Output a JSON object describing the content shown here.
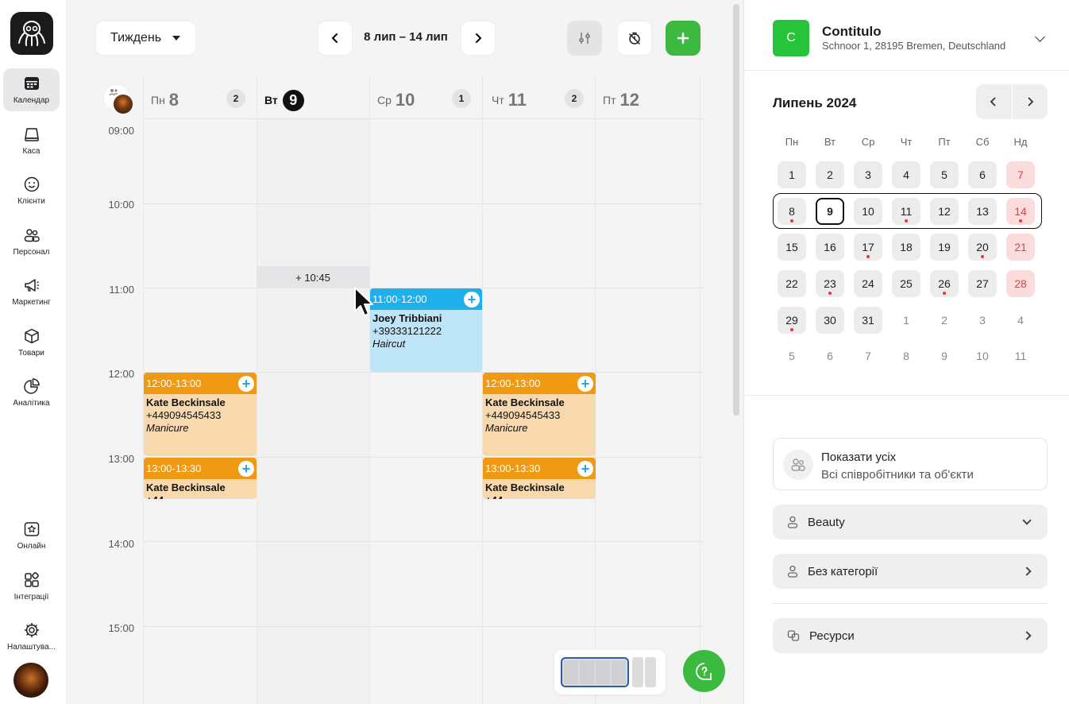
{
  "sidebar": {
    "items": [
      {
        "label": "Календар",
        "icon": "calendar-icon"
      },
      {
        "label": "Каса",
        "icon": "cash-register-icon"
      },
      {
        "label": "Клієнти",
        "icon": "smile-icon"
      },
      {
        "label": "Персонал",
        "icon": "staff-icon"
      },
      {
        "label": "Маркетинг",
        "icon": "megaphone-icon"
      },
      {
        "label": "Товари",
        "icon": "box-icon"
      },
      {
        "label": "Аналітика",
        "icon": "pie-chart-icon"
      },
      {
        "label": "Онлайн",
        "icon": "star-icon"
      },
      {
        "label": "Інтеграції",
        "icon": "integrations-icon"
      },
      {
        "label": "Налаштува...",
        "icon": "gear-icon"
      }
    ]
  },
  "toolbar": {
    "view_label": "Тиждень",
    "date_range": "8 лип – 14 лип"
  },
  "days": [
    {
      "weekday": "Пн",
      "num": "8",
      "count": "2"
    },
    {
      "weekday": "Вт",
      "num": "9",
      "count": ""
    },
    {
      "weekday": "Ср",
      "num": "10",
      "count": "1"
    },
    {
      "weekday": "Чт",
      "num": "11",
      "count": "2"
    },
    {
      "weekday": "Пт",
      "num": "12",
      "count": ""
    }
  ],
  "hours": [
    "09:00",
    "10:00",
    "11:00",
    "12:00",
    "13:00",
    "14:00",
    "15:00"
  ],
  "hover_slot": "+ 10:45",
  "events": [
    {
      "time": "11:00-12:00",
      "name": "Joey Tribbiani",
      "phone": "+39333121222",
      "service": "Haircut",
      "color": "blue"
    },
    {
      "time": "12:00-13:00",
      "name": "Kate Beckinsale",
      "phone": "+449094545433",
      "service": "Manicure",
      "color": "orange"
    },
    {
      "time": "13:00-13:30",
      "name": "Kate Beckinsale +44...",
      "phone": "",
      "service": "",
      "color": "orange"
    },
    {
      "time": "12:00-13:00",
      "name": "Kate Beckinsale",
      "phone": "+449094545433",
      "service": "Manicure",
      "color": "orange"
    },
    {
      "time": "13:00-13:30",
      "name": "Kate Beckinsale +44...",
      "phone": "",
      "service": "",
      "color": "orange"
    }
  ],
  "company": {
    "initial": "C",
    "name": "Contitulo",
    "address": "Schnoor 1, 28195 Bremen, Deutschland"
  },
  "mini_calendar": {
    "title": "Липень 2024",
    "weekdays": [
      "Пн",
      "Вт",
      "Ср",
      "Чт",
      "Пт",
      "Сб",
      "Нд"
    ],
    "weeks": [
      [
        "1",
        "2",
        "3",
        "4",
        "5",
        "6",
        "7"
      ],
      [
        "8",
        "9",
        "10",
        "11",
        "12",
        "13",
        "14"
      ],
      [
        "15",
        "16",
        "17",
        "18",
        "19",
        "20",
        "21"
      ],
      [
        "22",
        "23",
        "24",
        "25",
        "26",
        "27",
        "28"
      ],
      [
        "29",
        "30",
        "31",
        "1",
        "2",
        "3",
        "4"
      ],
      [
        "5",
        "6",
        "7",
        "8",
        "9",
        "10",
        "11"
      ]
    ],
    "selected": "9"
  },
  "filters": {
    "show_all_title": "Показати усіх",
    "show_all_subtitle": "Всі співробітники та об'єкти",
    "beauty": "Beauty",
    "no_category": "Без категорії",
    "resources": "Ресурси"
  },
  "colors": {
    "accent_green": "#3cb93f",
    "event_orange": "#ef9a12",
    "event_blue": "#1fb0ec",
    "weekend_red": "#d24747"
  }
}
